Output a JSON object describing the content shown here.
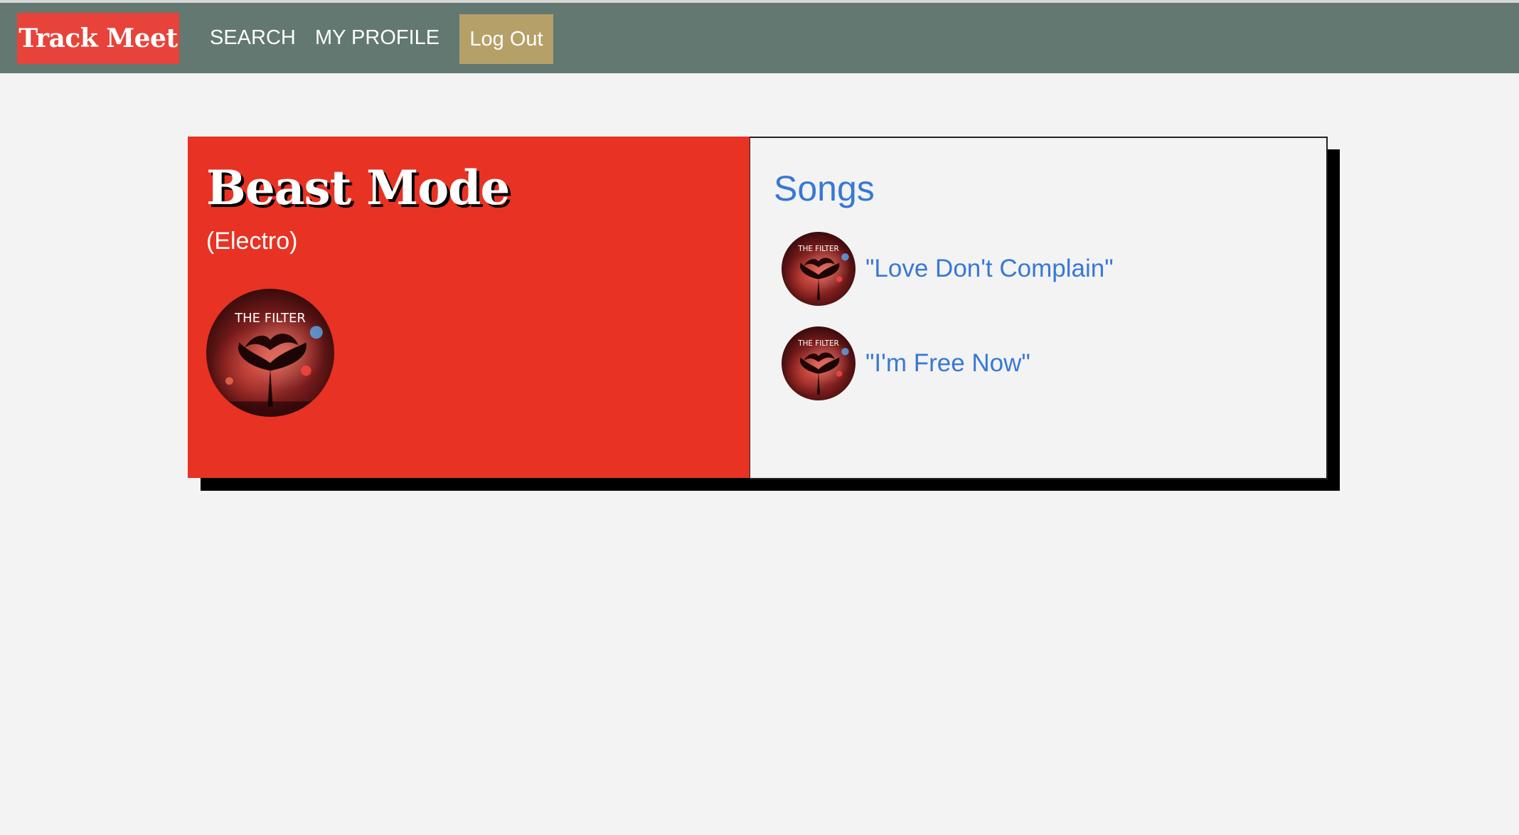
{
  "nav": {
    "brand": "Track Meet",
    "search_label": "SEARCH",
    "profile_label": "MY PROFILE",
    "logout_label": "Log Out"
  },
  "station": {
    "title": "Beast Mode",
    "genre": "(Electro)",
    "art_label": "THE FILTER"
  },
  "songs_panel": {
    "heading": "Songs",
    "items": [
      {
        "title": "\"Love Don't Complain\"",
        "art_label": "THE FILTER"
      },
      {
        "title": "\"I'm Free Now\"",
        "art_label": "THE FILTER"
      }
    ]
  },
  "colors": {
    "navbar": "#627871",
    "brand": "#e8433a",
    "logout": "#b5a068",
    "station_panel": "#e83223",
    "link": "#3778d6",
    "background": "#f3f3f3"
  }
}
